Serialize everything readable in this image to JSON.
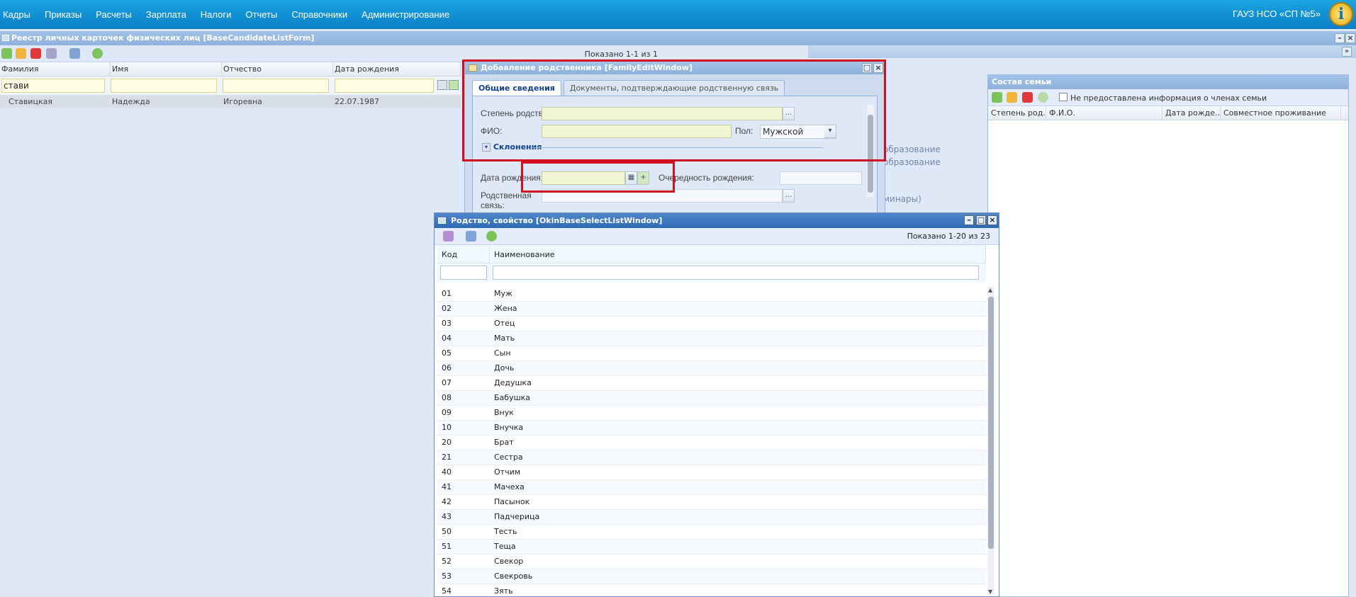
{
  "menu": [
    "Кадры",
    "Приказы",
    "Расчеты",
    "Зарплата",
    "Налоги",
    "Отчеты",
    "Справочники",
    "Администрирование"
  ],
  "org_name": "ГАУЗ НСО «СП №5»",
  "info_icon": "i",
  "list_form": {
    "title": "Реестр личных карточек физических лиц [BaseCandidateListForm]",
    "shown": "Показано 1-1 из 1",
    "columns": [
      "Фамилия",
      "Имя",
      "Отчество",
      "Дата рождения"
    ],
    "filter_surname": "стави",
    "row": {
      "surname": "Ставицкая",
      "name": "Надежда",
      "patronymic": "Игоревна",
      "birth": "22.07.1987"
    }
  },
  "right_panel": {
    "partial_text_1": "образование",
    "partial_text_2": "образование",
    "partial_text_3": "минары)"
  },
  "family": {
    "title": "Состав семьи",
    "no_info_label": "Не предоставлена информация о членах семьи",
    "columns": [
      "Степень род...",
      "Ф.И.О.",
      "Дата рожде...",
      "Совместное проживание"
    ]
  },
  "edit_window": {
    "title": "Добавление родственника [FamilyEditWindow]",
    "tab_general": "Общие сведения",
    "tab_docs": "Документы, подтверждающие родственную связь",
    "label_degree": "Степень родства:",
    "label_fio": "ФИО:",
    "label_gender": "Пол:",
    "gender_value": "Мужской",
    "section_declension": "Склонения",
    "label_birth": "Дата рождения:",
    "label_order": "Очередность рождения:",
    "label_relation_1": "Родственная",
    "label_relation_2": "связь:",
    "ellipsis": "..."
  },
  "select_window": {
    "title": "Родство, свойство [OkinBaseSelectListWindow]",
    "shown": "Показано 1-20 из 23",
    "col_code": "Код",
    "col_name": "Наименование",
    "rows": [
      {
        "code": "01",
        "name": "Муж"
      },
      {
        "code": "02",
        "name": "Жена"
      },
      {
        "code": "03",
        "name": "Отец"
      },
      {
        "code": "04",
        "name": "Мать"
      },
      {
        "code": "05",
        "name": "Сын"
      },
      {
        "code": "06",
        "name": "Дочь"
      },
      {
        "code": "07",
        "name": "Дедушка"
      },
      {
        "code": "08",
        "name": "Бабушка"
      },
      {
        "code": "09",
        "name": "Внук"
      },
      {
        "code": "10",
        "name": "Внучка"
      },
      {
        "code": "20",
        "name": "Брат"
      },
      {
        "code": "21",
        "name": "Сестра"
      },
      {
        "code": "40",
        "name": "Отчим"
      },
      {
        "code": "41",
        "name": "Мачеха"
      },
      {
        "code": "42",
        "name": "Пасынок"
      },
      {
        "code": "43",
        "name": "Падчерица"
      },
      {
        "code": "50",
        "name": "Тесть"
      },
      {
        "code": "51",
        "name": "Теща"
      },
      {
        "code": "52",
        "name": "Свекор"
      },
      {
        "code": "53",
        "name": "Свекровь"
      },
      {
        "code": "54",
        "name": "Зять"
      }
    ]
  },
  "colors": {
    "menu_bar": "#0b7ec5",
    "window_title": "#8eb2dd",
    "highlight": "#d01020",
    "required_field": "#f1f5d3"
  }
}
